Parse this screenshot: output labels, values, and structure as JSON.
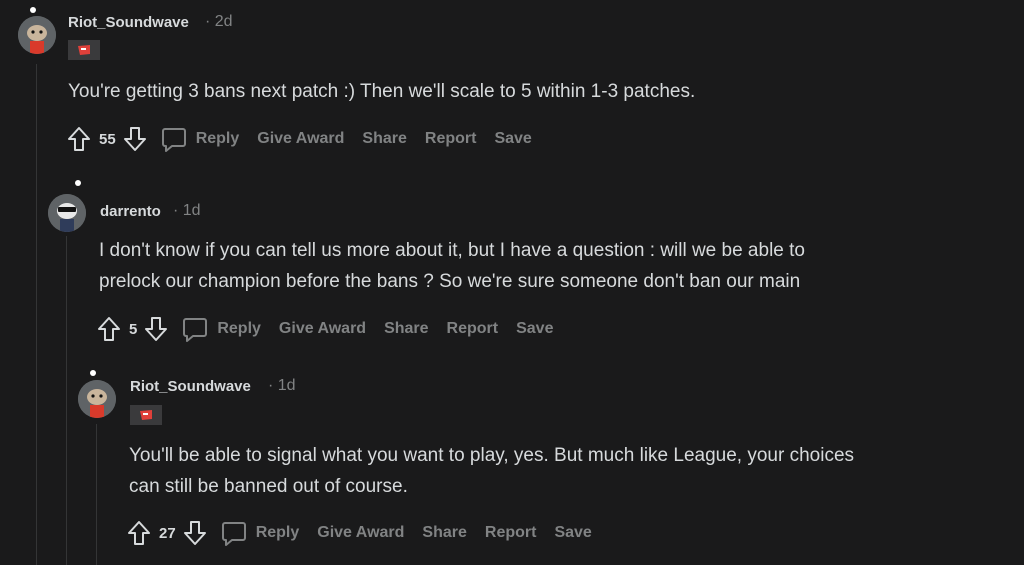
{
  "comments": [
    {
      "author": "Riot_Soundwave",
      "time": "· 2d",
      "flair_icon": "riot-fist-icon",
      "body_lines": [
        "You're getting 3 bans next patch :) Then we'll scale to 5 within 1-3 patches."
      ],
      "score": "55",
      "actions": {
        "reply": "Reply",
        "award": "Give Award",
        "share": "Share",
        "report": "Report",
        "save": "Save"
      }
    },
    {
      "author": "darrento",
      "time": "· 1d",
      "body_lines": [
        "I don't know if you can tell us more about it, but I have a question : will we be able to",
        "prelock our champion before the bans ? So we're sure someone don't ban our main"
      ],
      "score": "5",
      "actions": {
        "reply": "Reply",
        "award": "Give Award",
        "share": "Share",
        "report": "Report",
        "save": "Save"
      }
    },
    {
      "author": "Riot_Soundwave",
      "time": "· 1d",
      "flair_icon": "riot-fist-icon",
      "body_lines": [
        "You'll be able to signal what you want to play, yes. But much like League, your choices",
        "can still be banned out of course."
      ],
      "score": "27",
      "actions": {
        "reply": "Reply",
        "award": "Give Award",
        "share": "Share",
        "report": "Report",
        "save": "Save"
      }
    }
  ],
  "colors": {
    "background": "#1a1a1b",
    "text": "#d7dadc",
    "muted": "#818384",
    "flair_red": "#e0403a"
  }
}
